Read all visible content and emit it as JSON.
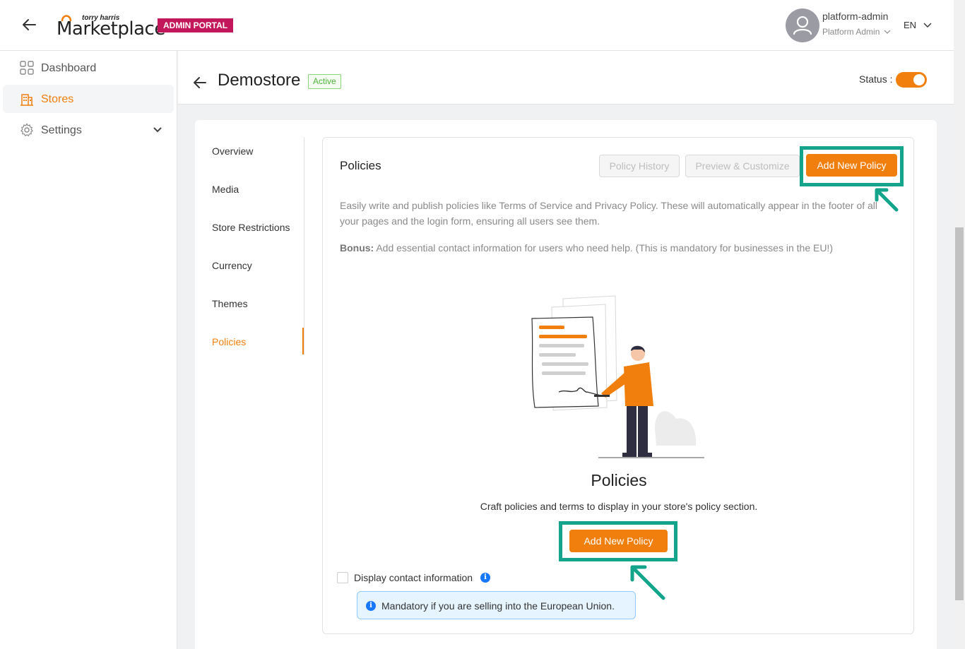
{
  "header": {
    "logo_small": "torry harris",
    "logo_big": "Marketplace",
    "portal_badge": "ADMIN PORTAL",
    "user_name": "platform-admin",
    "user_role": "Platform Admin",
    "language": "EN"
  },
  "sidebar": {
    "items": [
      {
        "label": "Dashboard",
        "icon": "grid-icon"
      },
      {
        "label": "Stores",
        "icon": "store-icon"
      },
      {
        "label": "Settings",
        "icon": "gear-icon"
      }
    ]
  },
  "page": {
    "title": "Demostore",
    "status_badge": "Active",
    "status_label": "Status :",
    "status_on": true
  },
  "tabs": [
    "Overview",
    "Media",
    "Store Restrictions",
    "Currency",
    "Themes",
    "Policies"
  ],
  "active_tab": "Policies",
  "policies": {
    "title": "Policies",
    "btn_history": "Policy History",
    "btn_preview": "Preview & Customize",
    "btn_add": "Add New Policy",
    "description": "Easily write and publish policies like Terms of Service and Privacy Policy. These will automatically appear in the footer of all your pages and the login form, ensuring all users see them.",
    "bonus_label": "Bonus:",
    "bonus_text": " Add essential contact information for users who need help. (This is mandatory for businesses in the EU!)",
    "empty_title": "Policies",
    "empty_subtitle": "Craft policies and terms to display in your store's policy section.",
    "empty_btn_add": "Add New Policy",
    "contact_label": "Display contact information",
    "notice": "Mandatory if you are selling into the European Union."
  },
  "colors": {
    "accent": "#f07f0e",
    "highlight": "#14a38b",
    "admin_badge": "#c2185b",
    "info": "#1677ff"
  }
}
